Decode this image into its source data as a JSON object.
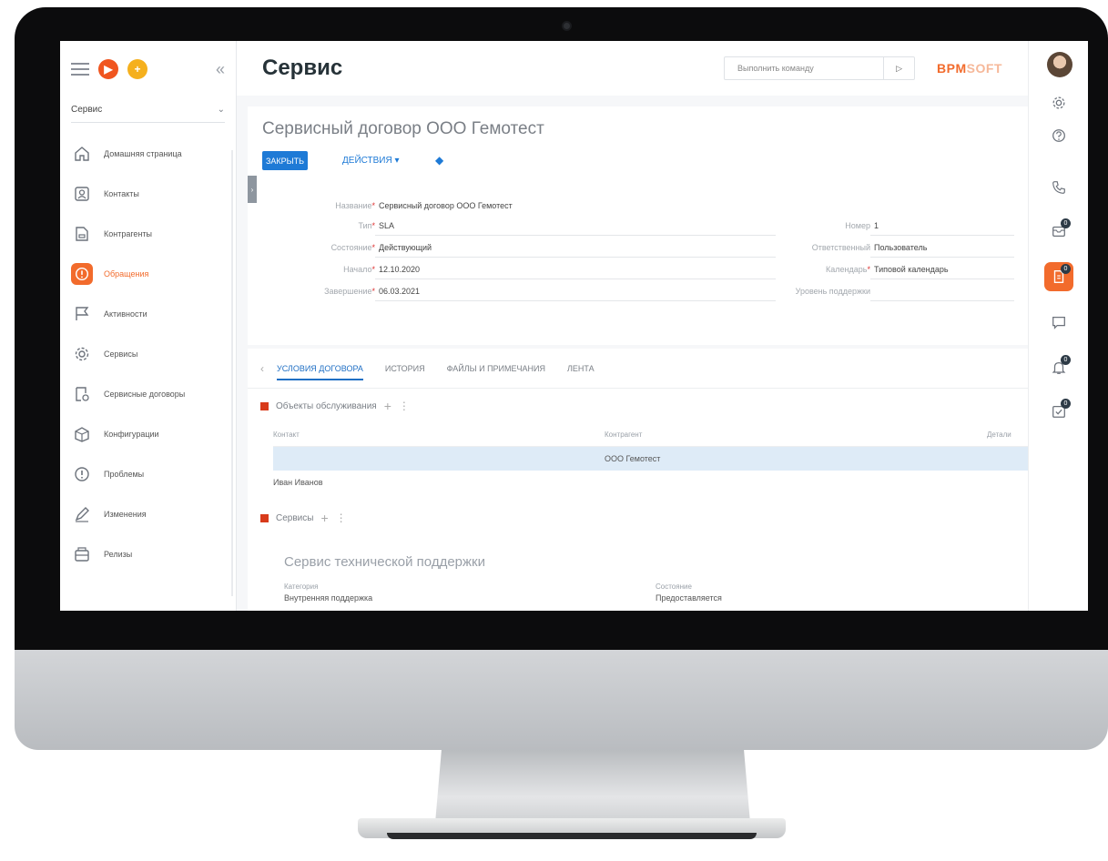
{
  "app": {
    "workspace": "Сервис",
    "page_title": "Сервис",
    "command_placeholder": "Выполнить команду",
    "logo_bold": "BPM",
    "logo_light": "SOFT"
  },
  "sidebar": {
    "items": [
      {
        "label": "Домашняя страница",
        "icon": "home-icon"
      },
      {
        "label": "Контакты",
        "icon": "contact-icon"
      },
      {
        "label": "Контрагенты",
        "icon": "account-icon"
      },
      {
        "label": "Обращения",
        "icon": "case-icon"
      },
      {
        "label": "Активности",
        "icon": "flag-icon"
      },
      {
        "label": "Сервисы",
        "icon": "gear-icon"
      },
      {
        "label": "Сервисные договоры",
        "icon": "service-agreement-icon"
      },
      {
        "label": "Конфигурации",
        "icon": "configuration-icon"
      },
      {
        "label": "Проблемы",
        "icon": "problem-icon"
      },
      {
        "label": "Изменения",
        "icon": "pencil-icon"
      },
      {
        "label": "Релизы",
        "icon": "release-icon"
      }
    ]
  },
  "record": {
    "title": "Сервисный договор ООО Гемотест",
    "close_label": "ЗАКРЫТЬ",
    "actions_label": "ДЕЙСТВИЯ ▾",
    "fields_left": [
      {
        "label": "Название",
        "value": "Сервисный договор ООО Гемотест"
      },
      {
        "label": "Тип",
        "value": "SLA"
      },
      {
        "label": "Состояние",
        "value": "Действующий"
      },
      {
        "label": "Начало",
        "value": "12.10.2020"
      },
      {
        "label": "Завершение",
        "value": "06.03.2021"
      }
    ],
    "fields_right": [
      {
        "label": "Номер",
        "value": "1"
      },
      {
        "label": "Ответственный",
        "value": "Пользователь"
      },
      {
        "label": "Календарь",
        "value": "Типовой календарь"
      },
      {
        "label": "Уровень поддержки",
        "value": ""
      }
    ]
  },
  "tabs": [
    "УСЛОВИЯ ДОГОВОРА",
    "ИСТОРИЯ",
    "ФАЙЛЫ И ПРИМЕЧАНИЯ",
    "ЛЕНТА"
  ],
  "objects": {
    "title": "Объекты обслуживания",
    "columns": [
      "Контакт",
      "Контрагент",
      "Детали"
    ],
    "rows": [
      {
        "contact": "",
        "account": "ООО Гемотест"
      },
      {
        "contact": "Иван Иванов",
        "account": ""
      }
    ]
  },
  "services": {
    "title": "Сервисы",
    "item_title": "Сервис технической поддержки",
    "category_label": "Категория",
    "category_value": "Внутренняя поддержка",
    "state_label": "Состояние",
    "state_value": "Предоставляется"
  },
  "right_panel": {
    "badges": [
      "0",
      "0",
      "0",
      "0"
    ]
  },
  "colors": {
    "accent": "#f26b2c",
    "primary": "#1e7ad6",
    "danger": "#d83b1b"
  }
}
